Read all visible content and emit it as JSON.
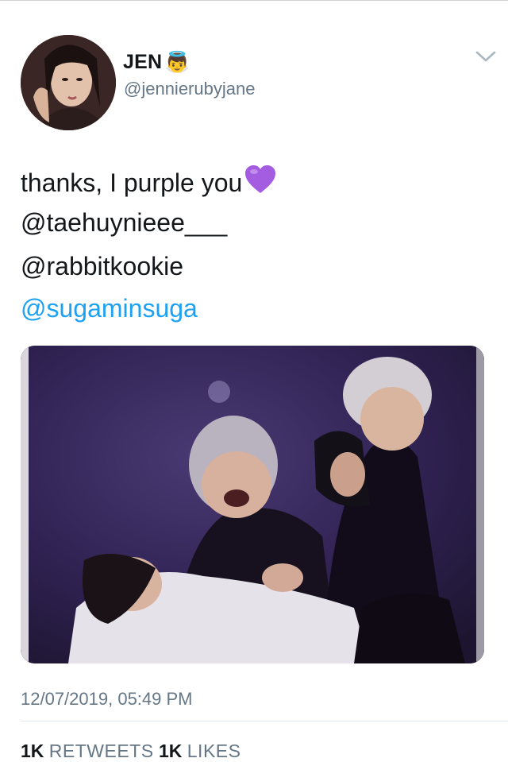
{
  "author": {
    "display_name": "JEN",
    "badge_emoji": "👼",
    "handle": "@jennierubyjane"
  },
  "menu": {
    "icon": "chevron-down-icon"
  },
  "tweet": {
    "line1": "thanks, I purple you",
    "line1_emoji": "purple-heart-icon",
    "mention1": "@taehuynieee___",
    "mention2": "@rabbitkookie",
    "mention3": "@sugaminsuga"
  },
  "timestamp": "12/07/2019, 05:49 PM",
  "stats": {
    "retweets_count": "1K",
    "retweets_label": "RETWEETS",
    "likes_count": "1K",
    "likes_label": "LIKES"
  },
  "colors": {
    "link": "#1da1f2",
    "secondary_text": "#657786",
    "heart": "#a45de0",
    "media_bg": "#2c1f45"
  }
}
